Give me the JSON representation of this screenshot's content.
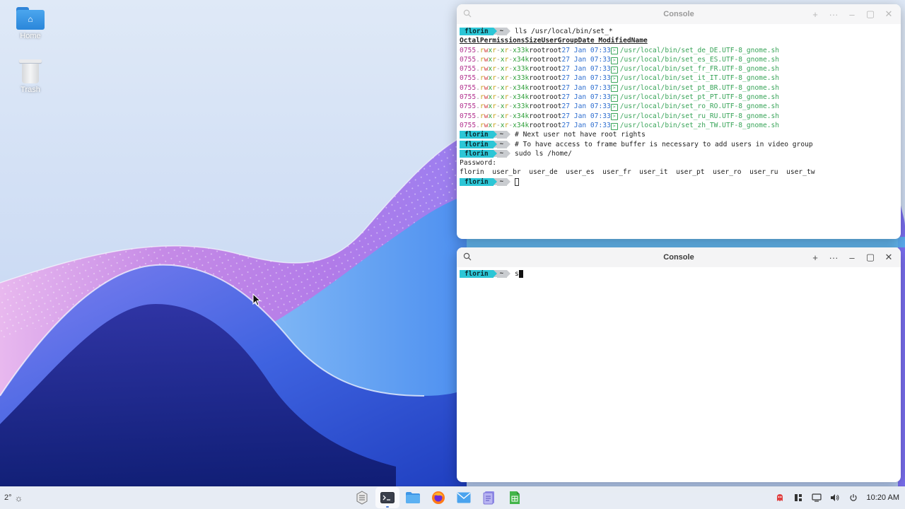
{
  "desktop": {
    "icons": [
      {
        "label": "Home",
        "icon": "home-folder-icon"
      },
      {
        "label": "Trash",
        "icon": "trash-icon"
      }
    ]
  },
  "console_top": {
    "title": "Console",
    "lines": [
      {
        "type": "prompt",
        "user": "florin",
        "dir": "~",
        "cmd": "lls /usr/local/bin/set_*"
      },
      {
        "type": "header",
        "cols": [
          "Octal",
          "Permissions",
          "Size",
          "User",
          "Group",
          "Date Modified",
          "Name"
        ]
      },
      {
        "type": "file",
        "octal": "0755",
        "size": "33k",
        "user": "root",
        "group": "root",
        "date": "27 Jan 07:33",
        "name": "/usr/local/bin/set_de_DE.UTF-8_gnome.sh"
      },
      {
        "type": "file",
        "octal": "0755",
        "size": "34k",
        "user": "root",
        "group": "root",
        "date": "27 Jan 07:33",
        "name": "/usr/local/bin/set_es_ES.UTF-8_gnome.sh"
      },
      {
        "type": "file",
        "octal": "0755",
        "size": "33k",
        "user": "root",
        "group": "root",
        "date": "27 Jan 07:33",
        "name": "/usr/local/bin/set_fr_FR.UTF-8_gnome.sh"
      },
      {
        "type": "file",
        "octal": "0755",
        "size": "33k",
        "user": "root",
        "group": "root",
        "date": "27 Jan 07:33",
        "name": "/usr/local/bin/set_it_IT.UTF-8_gnome.sh"
      },
      {
        "type": "file",
        "octal": "0755",
        "size": "34k",
        "user": "root",
        "group": "root",
        "date": "27 Jan 07:33",
        "name": "/usr/local/bin/set_pt_BR.UTF-8_gnome.sh"
      },
      {
        "type": "file",
        "octal": "0755",
        "size": "34k",
        "user": "root",
        "group": "root",
        "date": "27 Jan 07:33",
        "name": "/usr/local/bin/set_pt_PT.UTF-8_gnome.sh"
      },
      {
        "type": "file",
        "octal": "0755",
        "size": "33k",
        "user": "root",
        "group": "root",
        "date": "27 Jan 07:33",
        "name": "/usr/local/bin/set_ro_RO.UTF-8_gnome.sh"
      },
      {
        "type": "file",
        "octal": "0755",
        "size": "34k",
        "user": "root",
        "group": "root",
        "date": "27 Jan 07:33",
        "name": "/usr/local/bin/set_ru_RU.UTF-8_gnome.sh"
      },
      {
        "type": "file",
        "octal": "0755",
        "size": "34k",
        "user": "root",
        "group": "root",
        "date": "27 Jan 07:33",
        "name": "/usr/local/bin/set_zh_TW.UTF-8_gnome.sh"
      },
      {
        "type": "prompt",
        "user": "florin",
        "dir": "~",
        "cmd": "# Next user not have root rights"
      },
      {
        "type": "prompt",
        "user": "florin",
        "dir": "~",
        "cmd": "# To have access to frame buffer is necessary to add users in video group"
      },
      {
        "type": "prompt",
        "user": "florin",
        "dir": "~",
        "cmd": "sudo ls /home/"
      },
      {
        "type": "text",
        "text": "Password:"
      },
      {
        "type": "text",
        "text": "florin  user_br  user_de  user_es  user_fr  user_it  user_pt  user_ro  user_ru  user_tw"
      },
      {
        "type": "prompt-cursor",
        "user": "florin",
        "dir": "~",
        "cmd": ""
      }
    ]
  },
  "console_bottom": {
    "title": "Console",
    "lines": [
      {
        "type": "prompt-active",
        "user": "florin",
        "dir": "~",
        "cmd": "s"
      }
    ]
  },
  "taskbar": {
    "weather": "2°",
    "weather_icon": "sun-icon",
    "apps": [
      {
        "name": "app-launcher",
        "icon": "launcher-icon"
      },
      {
        "name": "console",
        "icon": "terminal-icon",
        "active": true
      },
      {
        "name": "files",
        "icon": "folder-icon"
      },
      {
        "name": "firefox",
        "icon": "firefox-icon"
      },
      {
        "name": "mail",
        "icon": "mail-icon"
      },
      {
        "name": "document-viewer",
        "icon": "document-icon"
      },
      {
        "name": "spreadsheet",
        "icon": "spreadsheet-icon"
      }
    ],
    "tray": [
      {
        "name": "security",
        "icon": "ghost-icon"
      },
      {
        "name": "workspaces",
        "icon": "grid-icon"
      },
      {
        "name": "network",
        "icon": "network-icon"
      },
      {
        "name": "volume",
        "icon": "volume-icon"
      },
      {
        "name": "power",
        "icon": "power-icon"
      }
    ],
    "clock": "10:20 AM"
  },
  "colors": {
    "prompt_user_bg": "#2cc6d6",
    "prompt_dir_bg": "#c9ccd0",
    "octal": "#b2328f",
    "size": "#2e9f3a",
    "date": "#2f6fd0",
    "name": "#3aa55a"
  }
}
